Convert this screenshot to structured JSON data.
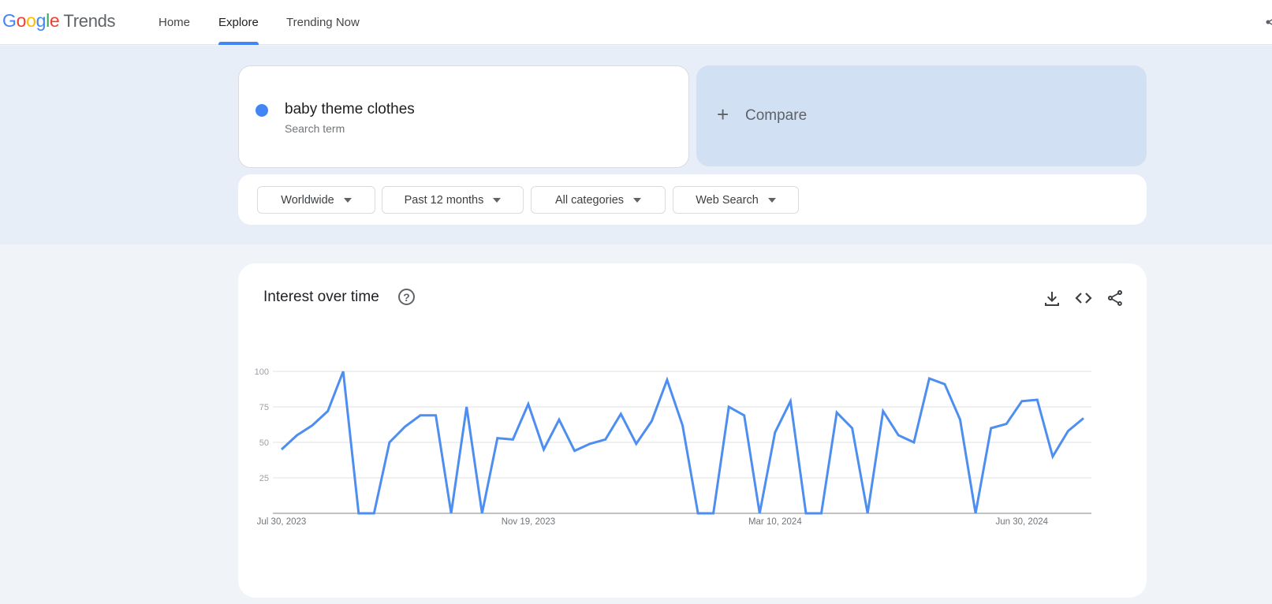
{
  "header": {
    "logo_google": [
      "G",
      "o",
      "o",
      "g",
      "l",
      "e"
    ],
    "logo_product": "Trends",
    "nav": [
      {
        "label": "Home",
        "active": false
      },
      {
        "label": "Explore",
        "active": true
      },
      {
        "label": "Trending Now",
        "active": false
      }
    ],
    "share_icon": "share-icon"
  },
  "search": {
    "term": "baby theme clothes",
    "term_type": "Search term",
    "term_color": "#4285f4",
    "compare_label": "Compare",
    "compare_icon": "plus-icon"
  },
  "filters": [
    {
      "label": "Worldwide"
    },
    {
      "label": "Past 12 months"
    },
    {
      "label": "All categories"
    },
    {
      "label": "Web Search"
    }
  ],
  "card": {
    "title": "Interest over time",
    "help_icon": "?",
    "actions": [
      "download-icon",
      "embed-icon",
      "share-icon"
    ]
  },
  "colors": {
    "accent": "#4285f4",
    "series": "#4d8ef0",
    "grid": "#e0e0e0",
    "axis": "#9e9e9e"
  },
  "chart_data": {
    "type": "line",
    "title": "Interest over time",
    "xlabel": "",
    "ylabel": "",
    "ylim": [
      0,
      100
    ],
    "yticks": [
      25,
      50,
      75,
      100
    ],
    "ytick_labels": [
      "25",
      "50",
      "75",
      "100"
    ],
    "grid": true,
    "legend": "none",
    "x_tick_labels": [
      {
        "index": 0,
        "label": "Jul 30, 2023"
      },
      {
        "index": 16,
        "label": "Nov 19, 2023"
      },
      {
        "index": 32,
        "label": "Mar 10, 2024"
      },
      {
        "index": 48,
        "label": "Jun 30, 2024"
      }
    ],
    "x_start": "Jul 30, 2023",
    "x_interval": "weekly",
    "series": [
      {
        "name": "baby theme clothes",
        "values": [
          45,
          55,
          62,
          72,
          100,
          0,
          0,
          50,
          61,
          69,
          69,
          0,
          75,
          0,
          53,
          52,
          77,
          45,
          66,
          44,
          49,
          52,
          70,
          49,
          65,
          94,
          62,
          0,
          0,
          75,
          69,
          0,
          57,
          79,
          0,
          0,
          71,
          60,
          0,
          72,
          55,
          50,
          95,
          91,
          66,
          0,
          60,
          63,
          79,
          80,
          40,
          58,
          67
        ]
      }
    ]
  }
}
